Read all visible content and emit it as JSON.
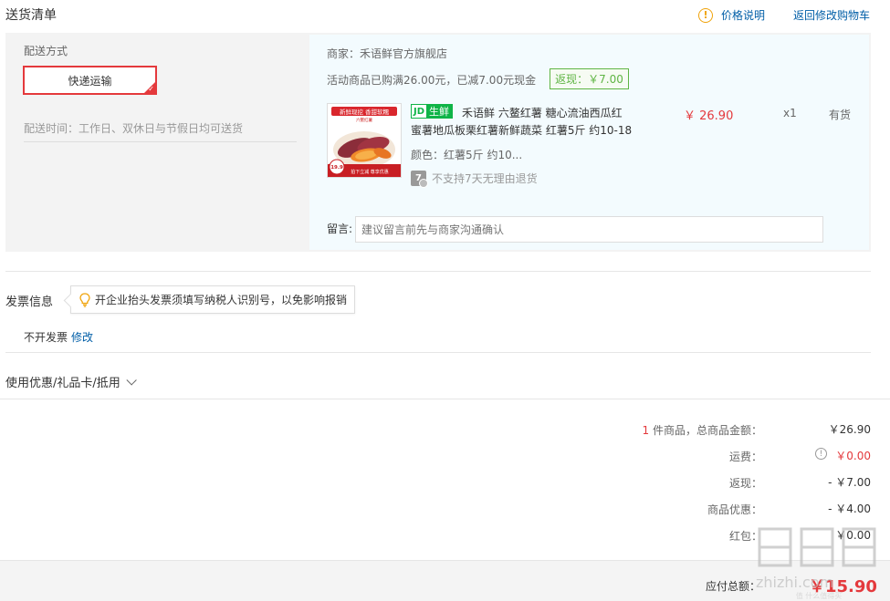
{
  "header": {
    "title": "送货清单",
    "price_explain": "价格说明",
    "back_to_cart": "返回修改购物车"
  },
  "shipping": {
    "label": "配送方式",
    "method": "快递运输",
    "time": "配送时间：工作日、双休日与节假日均可送货"
  },
  "store": {
    "merchant": "商家：禾语鲜官方旗舰店",
    "promo": "活动商品已购满26.00元，已减7.00元现金",
    "rebate": "返现：￥7.00"
  },
  "product": {
    "tag_left": "JD",
    "tag_right": "生鲜",
    "name_line1": "禾语鲜 六鳌红薯 糖心流油西瓜红",
    "name_line2": "蜜薯地瓜板栗红薯新鲜蔬菜 红薯5斤 约10-18",
    "color": "颜色：红薯5斤 约10...",
    "no_return": "不支持7天无理由退货",
    "price": "￥ 26.90",
    "qty": "x1",
    "stock": "有货",
    "img_banner": "新鲜现挖 香甜软糯",
    "img_sub": "六鳌红薯",
    "img_price": "19.9",
    "img_footer": "拍下立减 尊享优惠"
  },
  "remark": {
    "label": "留言:",
    "placeholder": "建议留言前先与商家沟通确认"
  },
  "invoice": {
    "title": "发票信息",
    "tip": "开企业抬头发票须填写纳税人识别号，以免影响报销",
    "status": "不开发票",
    "edit": "修改"
  },
  "coupon": {
    "label": "使用优惠/礼品卡/抵用"
  },
  "summary": {
    "count": "1",
    "goods_label": "件商品，总商品金额：",
    "goods_value": "￥26.90",
    "freight_label": "运费：",
    "freight_value": "￥0.00",
    "rebate_label": "返现：",
    "rebate_value": "- ￥7.00",
    "discount_label": "商品优惠：",
    "discount_value": "- ￥4.00",
    "redpacket_label": "红包：",
    "redpacket_value": "￥0.00",
    "total_label": "应付总额：",
    "total_value": "￥15.90"
  },
  "watermark": {
    "text": "值 什么值得买",
    "url": "zhizhi.com"
  },
  "colors": {
    "accent_red": "#e4393c",
    "link_blue": "#005ea7",
    "green": "#5fb544",
    "warn_orange": "#f0a30a"
  }
}
